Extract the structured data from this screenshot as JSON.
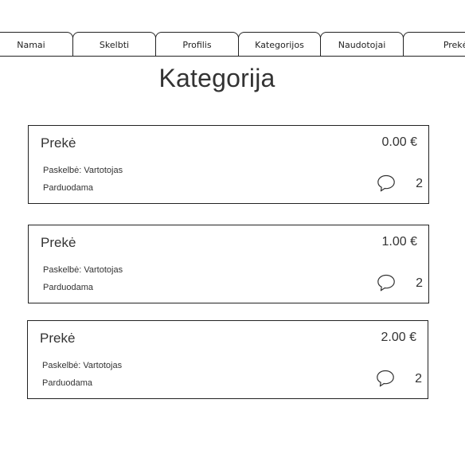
{
  "nav": {
    "tabs": [
      {
        "label": "Namai"
      },
      {
        "label": "Skelbti"
      },
      {
        "label": "Profilis"
      },
      {
        "label": "Kategorijos"
      },
      {
        "label": "Naudotojai"
      },
      {
        "label": "Prekės"
      }
    ]
  },
  "page": {
    "title": "Kategorija"
  },
  "items": [
    {
      "name": "Prekė",
      "price": "0.00 €",
      "author": "Paskelbė: Vartotojas",
      "status": "Parduodama",
      "comment_icon": "speech-bubble-icon",
      "comment_count": "2"
    },
    {
      "name": "Prekė",
      "price": "1.00 €",
      "author": "Paskelbė: Vartotojas",
      "status": "Parduodama",
      "comment_icon": "speech-bubble-icon",
      "comment_count": "2"
    },
    {
      "name": "Prekė",
      "price": "2.00 €",
      "author": "Paskelbė: Vartotojas",
      "status": "Parduodama",
      "comment_icon": "speech-bubble-icon",
      "comment_count": "2"
    }
  ]
}
